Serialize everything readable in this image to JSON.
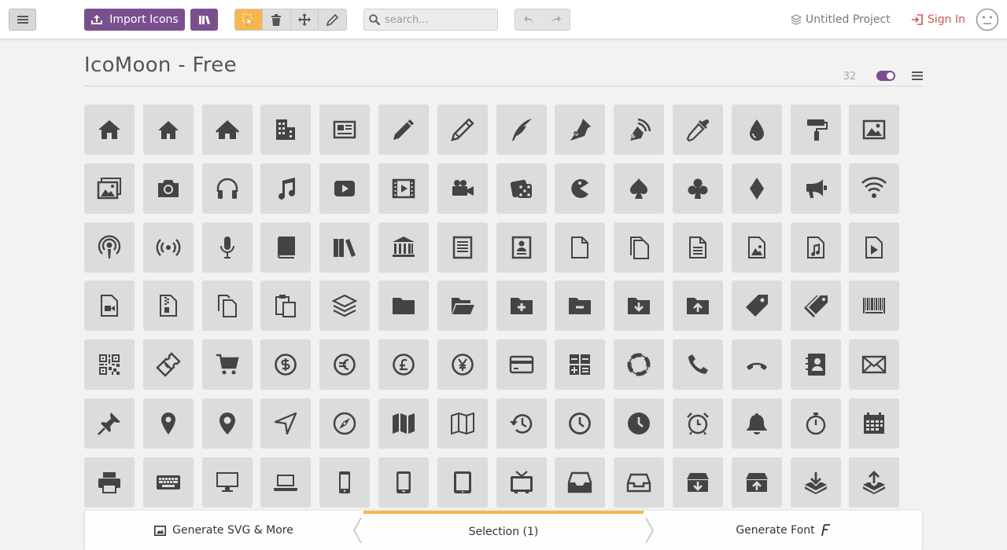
{
  "toolbar": {
    "import_label": "Import Icons",
    "search_placeholder": "search...",
    "project_name": "Untitled Project",
    "signin_label": "Sign In"
  },
  "iconset": {
    "title": "IcoMoon - Free",
    "icon_size": "32",
    "toggle_on": true
  },
  "icons": [
    "home",
    "home2",
    "home3",
    "office",
    "newspaper",
    "pencil",
    "pencil2",
    "quill",
    "pen",
    "blog",
    "eyedropper",
    "droplet",
    "paint-format",
    "image",
    "images",
    "camera",
    "headphones",
    "music",
    "play",
    "film",
    "video-camera",
    "dice",
    "pacman",
    "spades",
    "clubs",
    "diamonds",
    "bullhorn",
    "connection",
    "podcast",
    "feed",
    "mic",
    "book",
    "books",
    "library",
    "file-text",
    "profile",
    "file-empty",
    "files-empty",
    "file-text2",
    "file-picture",
    "file-music",
    "file-play",
    "file-video",
    "file-zip",
    "copy",
    "paste",
    "stack",
    "folder",
    "folder-open",
    "folder-plus",
    "folder-minus",
    "folder-download",
    "folder-upload",
    "price-tag",
    "price-tags",
    "barcode",
    "qrcode",
    "ticket",
    "cart",
    "coin-dollar",
    "coin-euro",
    "coin-pound",
    "coin-yen",
    "credit-card",
    "calculator",
    "lifebuoy",
    "phone",
    "phone-hang-up",
    "address-book",
    "envelop",
    "pushpin",
    "location",
    "location2",
    "compass",
    "compass2",
    "map",
    "map2",
    "history",
    "clock",
    "clock2",
    "alarm",
    "bell",
    "stopwatch",
    "calendar",
    "printer",
    "keyboard",
    "display",
    "laptop",
    "mobile",
    "mobile2",
    "tablet",
    "tv",
    "drawer",
    "drawer2",
    "box-add",
    "box-remove",
    "download",
    "upload"
  ],
  "bottom": {
    "svg_label": "Generate SVG & More",
    "selection_label": "Selection (1)",
    "font_label": "Generate Font"
  },
  "colors": {
    "accent_purple": "#7a4f8f",
    "selection_orange": "#f7b74a",
    "signin_red": "#d9534f",
    "icon_tile": "#dcdcdc",
    "icon_glyph": "#444444"
  }
}
